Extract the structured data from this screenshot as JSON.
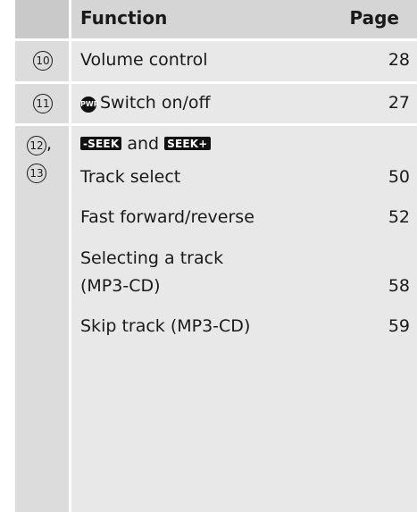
{
  "header": {
    "function": "Function",
    "page": "Page"
  },
  "rows": [
    {
      "num": "10",
      "label": "Volume control",
      "page": "28"
    },
    {
      "num": "11",
      "icon_text": "PWR",
      "label": "Switch on/off",
      "page": "27"
    }
  ],
  "group": {
    "num1": "12",
    "num_sep": ",",
    "num2": "13",
    "seek_minus": "-SEEK",
    "and": "and",
    "seek_plus": "SEEK+",
    "items": [
      {
        "label": "Track select",
        "page": "50"
      },
      {
        "label": "Fast forward/reverse",
        "page": "52"
      },
      {
        "label_line1": "Selecting a track",
        "label_line2": "(MP3-CD)",
        "page": "58"
      },
      {
        "label": "Skip track (MP3-CD)",
        "page": "59"
      }
    ]
  }
}
